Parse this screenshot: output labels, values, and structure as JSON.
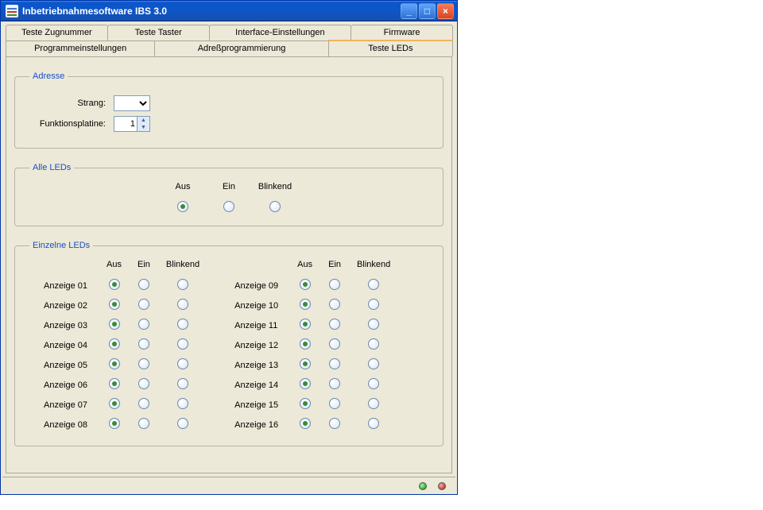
{
  "window": {
    "title": "Inbetriebnahmesoftware IBS 3.0"
  },
  "tabs": {
    "row1": [
      "Teste Zugnummer",
      "Teste Taster",
      "Interface-Einstellungen",
      "Firmware"
    ],
    "row2": [
      "Programmeinstellungen",
      "Adreßprogrammierung",
      "Teste LEDs"
    ],
    "active": "Teste LEDs"
  },
  "groups": {
    "addr": {
      "legend": "Adresse",
      "strang_label": "Strang:",
      "funktionsplatine_label": "Funktionsplatine:",
      "funktionsplatine_value": "1"
    },
    "all": {
      "legend": "Alle LEDs",
      "options": [
        "Aus",
        "Ein",
        "Blinkend"
      ],
      "selected": 0
    },
    "single": {
      "legend": "Einzelne LEDs",
      "columns": [
        "Aus",
        "Ein",
        "Blinkend"
      ],
      "left": [
        "Anzeige 01",
        "Anzeige 02",
        "Anzeige 03",
        "Anzeige 04",
        "Anzeige 05",
        "Anzeige 06",
        "Anzeige 07",
        "Anzeige 08"
      ],
      "right": [
        "Anzeige 09",
        "Anzeige 10",
        "Anzeige 11",
        "Anzeige 12",
        "Anzeige 13",
        "Anzeige 14",
        "Anzeige 15",
        "Anzeige 16"
      ],
      "selected": 0
    }
  },
  "status": {
    "green": true,
    "red": true
  }
}
